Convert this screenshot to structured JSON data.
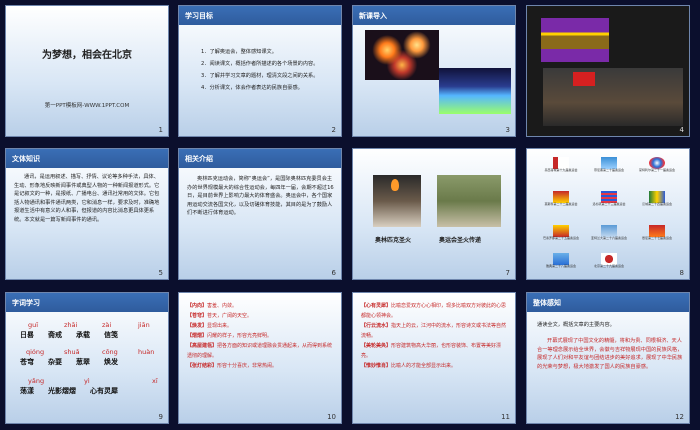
{
  "colors": {
    "background": "#0b0f2d",
    "header": "#2f5c9d",
    "accent_red": "#c62828"
  },
  "slides": [
    {
      "num": "1",
      "title": "为梦想，相会在北京",
      "footer": "第一PPT模板网-WWW.1PPT.COM"
    },
    {
      "num": "2",
      "label": "学习目标",
      "goals": [
        "1．了解奥运会，整体感知课文。",
        "2．阅读课文，概括作者所描述的各个场景的内容。",
        "3．了解并学习文章的题材，理清文段之间的关系。",
        "4．分析课文，体会作者表达的民族自豪感。"
      ]
    },
    {
      "num": "3",
      "label": "新课导入"
    },
    {
      "num": "4"
    },
    {
      "num": "5",
      "label": "文体知识",
      "body": "通讯，是运用叙述、描写、抒情、议论等多种手法，具体、生动、形象地反映新闻事件或典型人物的一种新闻报道形式。它是记叙文的一种，是报纸、广播电台、通讯社常用的文体。它包括人物通讯和事件通讯两类，它和消息一样，要求及时，准确地报道生活中有意义的人和事，但报道的内容比消息更具体更系统。本文就是一篇写新闻事件的通讯。"
    },
    {
      "num": "6",
      "label": "相关介绍",
      "body": "奥林匹克运动会，简称“奥运会”，是国际奥林匹克委员会主办的世界规模最大的综合性运动会，每四年一届，会期不超过16日，是目前世界上影响力最大的体育盛会。奥运会中，各个国家用运动交流各国文化，以及切磋体育技能，其目的是为了鼓励人们不断进行体育运动。"
    },
    {
      "num": "7",
      "cap1": "古希腊奥林匹克圣火",
      "cap2": "奥运会圣火传递",
      "cap1_short": "奥林匹克圣火",
      "cap2_short": "奥运会圣火传递"
    },
    {
      "num": "8",
      "logos": [
        "墨西哥城第十九届奥运会",
        "慕尼黑第二十届奥运会",
        "蒙特利尔第二十一届奥运会",
        "莫斯科第二十二届奥运会",
        "洛杉矶第二十三届奥运会",
        "汉城第二十四届奥运会",
        "巴塞罗那第二十五届奥运会",
        "亚特兰大第二十六届奥运会",
        "悉尼第二十七届奥运会",
        "雅典第二十八届奥运会",
        "北京第二十九届奥运会"
      ]
    },
    {
      "num": "9",
      "label": "字词学习",
      "words": [
        {
          "py": "guī",
          "w1": "日",
          "r": "晷"
        },
        {
          "py": "zhāi",
          "w1": "斋",
          "r": "戒"
        },
        {
          "py": "zài",
          "w1": "承",
          "r": "载"
        },
        {
          "py": "jiān",
          "w1": "信",
          "r": "笺"
        },
        {
          "py": "qióng",
          "w1": "苍",
          "r": "穹"
        },
        {
          "py": "shuǎ",
          "w1": "",
          "r": "耍"
        },
        {
          "py": "cōng",
          "w1": "",
          "r": "葱"
        },
        {
          "py": "huàn",
          "w1": "",
          "r": "焕"
        },
        {
          "py": "yǎng",
          "w1": "",
          "r": "漾"
        },
        {
          "py": "yì",
          "w1": "光影",
          "r": "熠"
        },
        {
          "py": "xī",
          "w1": "心有灵",
          "r": "犀"
        }
      ],
      "lines": [
        "日晷　　斋戒　　承载　　信笺",
        "苍穹　　杂耍　　葱翠　　焕发",
        "荡漾　　光影熠熠　　心有灵犀"
      ]
    },
    {
      "num": "10",
      "items": [
        {
          "k": "【内向】",
          "v": "害羞、内敛。"
        },
        {
          "k": "【苍穹】",
          "v": "苍天，广阔的天空。"
        },
        {
          "k": "【焕发】",
          "v": "显现出来。"
        },
        {
          "k": "【熠熠】",
          "v": "闪耀的样子，形容光亮鲜明。"
        },
        {
          "k": "【高屋建瓴】",
          "v": "把各方面的知识或道理融会贯通起来，从而得到系统透彻的理解。"
        },
        {
          "k": "【张灯结彩】",
          "v": "形容十分喜庆，非常热闹。"
        }
      ]
    },
    {
      "num": "11",
      "items": [
        {
          "k": "【心有灵犀】",
          "v": "比喻恋爱双方心心相印，现多比喻双方对彼此的心思都能心领神会。"
        },
        {
          "k": "【行云流水】",
          "v": "指天上的云，江河中的流水，形容诗文或书法等自然流畅。"
        },
        {
          "k": "【美轮美奂】",
          "v": "形容建筑物高大华丽，也形容装饰、布置等美好漂亮。"
        },
        {
          "k": "【惟妙惟肖】",
          "v": "比喻人的才能全部显示出来。"
        }
      ]
    },
    {
      "num": "12",
      "label": "整体感知",
      "body1": "通读全文，概括文章的主要内容。",
      "body2": "开幕式展现了中国文化的精髓，将和为贵、同根相济、天人合一等理念展示给全世界，会徽与吉祥物展现中国的民族风格，展现了人们对和平友谊与团结进步的美好追求，展现了中华民族的光荣与梦想，极大地激发了国人的民族自豪感。"
    }
  ]
}
